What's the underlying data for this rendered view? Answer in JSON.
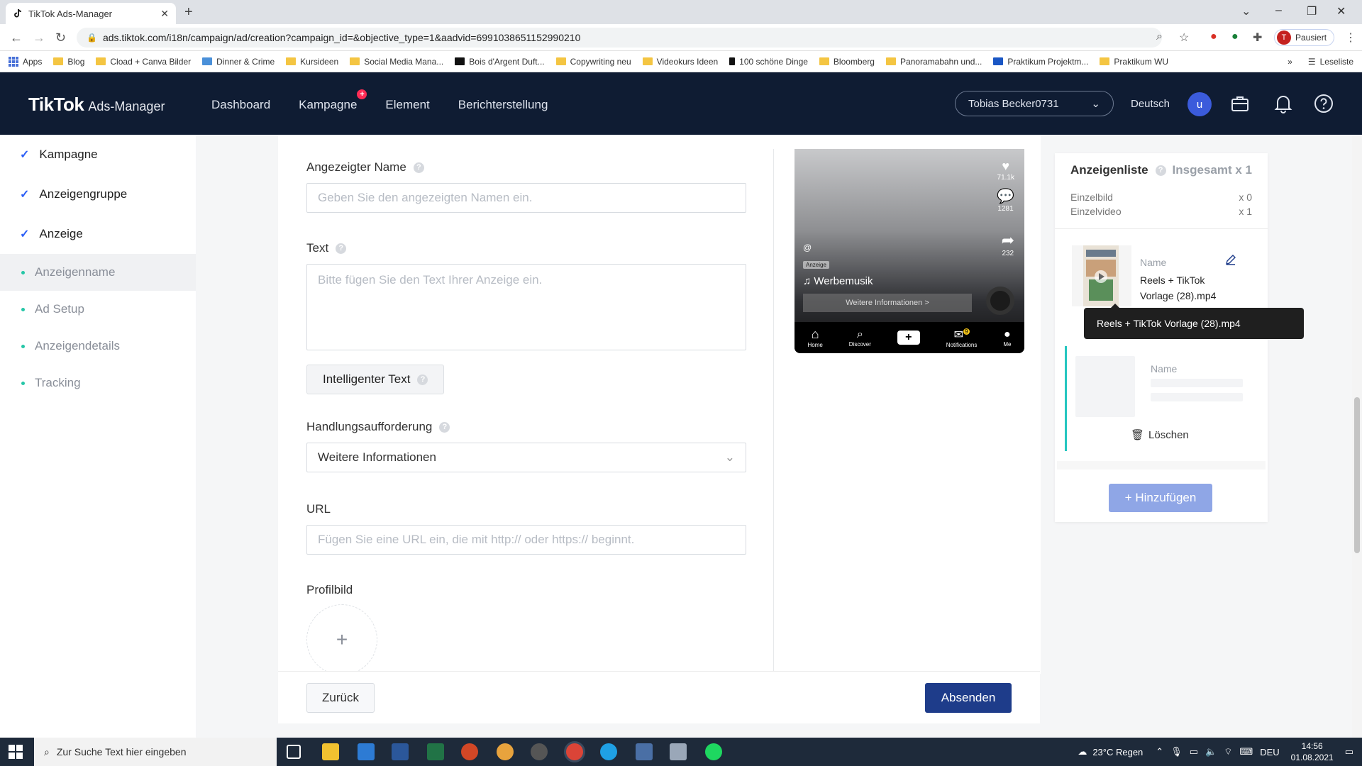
{
  "browser": {
    "tab_title": "TikTok Ads-Manager",
    "url": "ads.tiktok.com/i18n/campaign/ad/creation?campaign_id=&objective_type=1&aadvid=6991038651152990210",
    "profile_label": "Pausiert",
    "profile_initial": "T",
    "bookmarks": [
      "Apps",
      "Blog",
      "Cload + Canva Bilder",
      "Dinner & Crime",
      "Kursideen",
      "Social Media Mana...",
      "Bois d'Argent Duft...",
      "Copywriting neu",
      "Videokurs Ideen",
      "100 schöne Dinge",
      "Bloomberg",
      "Panoramabahn und...",
      "Praktikum Projektm...",
      "Praktikum WU"
    ],
    "reading_list": "Leseliste"
  },
  "header": {
    "logo": "TikTok",
    "logo_sub": "Ads-Manager",
    "nav": [
      "Dashboard",
      "Kampagne",
      "Element",
      "Berichterstellung"
    ],
    "account": "Tobias Becker0731",
    "language": "Deutsch",
    "user_initial": "u"
  },
  "sidebar": {
    "steps": [
      "Kampagne",
      "Anzeigengruppe",
      "Anzeige"
    ],
    "substeps": [
      "Anzeigenname",
      "Ad Setup",
      "Anzeigendetails",
      "Tracking"
    ]
  },
  "form": {
    "display_name_label": "Angezeigter Name",
    "display_name_placeholder": "Geben Sie den angezeigten Namen ein.",
    "text_label": "Text",
    "text_placeholder": "Bitte fügen Sie den Text Ihrer Anzeige ein.",
    "smart_text_button": "Intelligenter Text",
    "cta_label": "Handlungsaufforderung",
    "cta_value": "Weitere Informationen",
    "url_label": "URL",
    "url_placeholder": "Fügen Sie eine URL ein, die mit http:// oder https:// beginnt.",
    "profile_image_label": "Profilbild"
  },
  "preview": {
    "likes": "71.1k",
    "comments": "1281",
    "shares": "232",
    "handle": "@",
    "ad_badge": "Anzeige",
    "music": "Werbemusik",
    "cta": "Weitere Informationen >",
    "nav": [
      "Home",
      "Discover",
      "Notifications",
      "Me"
    ],
    "notif_count": "9"
  },
  "adlist": {
    "title": "Anzeigenliste",
    "total": "Insgesamt x 1",
    "stats": [
      {
        "label": "Einzelbild",
        "value": "x 0"
      },
      {
        "label": "Einzelvideo",
        "value": "x 1"
      }
    ],
    "item_name_label": "Name",
    "item_file": "Reels + TikTok Vorlage (28).mp4",
    "tooltip": "Reels + TikTok Vorlage (28).mp4",
    "delete": "Löschen",
    "add": "+ Hinzufügen"
  },
  "footer": {
    "back": "Zurück",
    "submit": "Absenden"
  },
  "taskbar": {
    "search_placeholder": "Zur Suche Text hier eingeben",
    "weather": "23°C Regen",
    "lang": "DEU",
    "time": "14:56",
    "date": "01.08.2021"
  },
  "colors": {
    "header_bg": "#0f1c33",
    "primary": "#1e3c8a",
    "accent_check": "#2c5ff6",
    "step_dot": "#25c6a7",
    "tiktok_red": "#fe2c55"
  }
}
